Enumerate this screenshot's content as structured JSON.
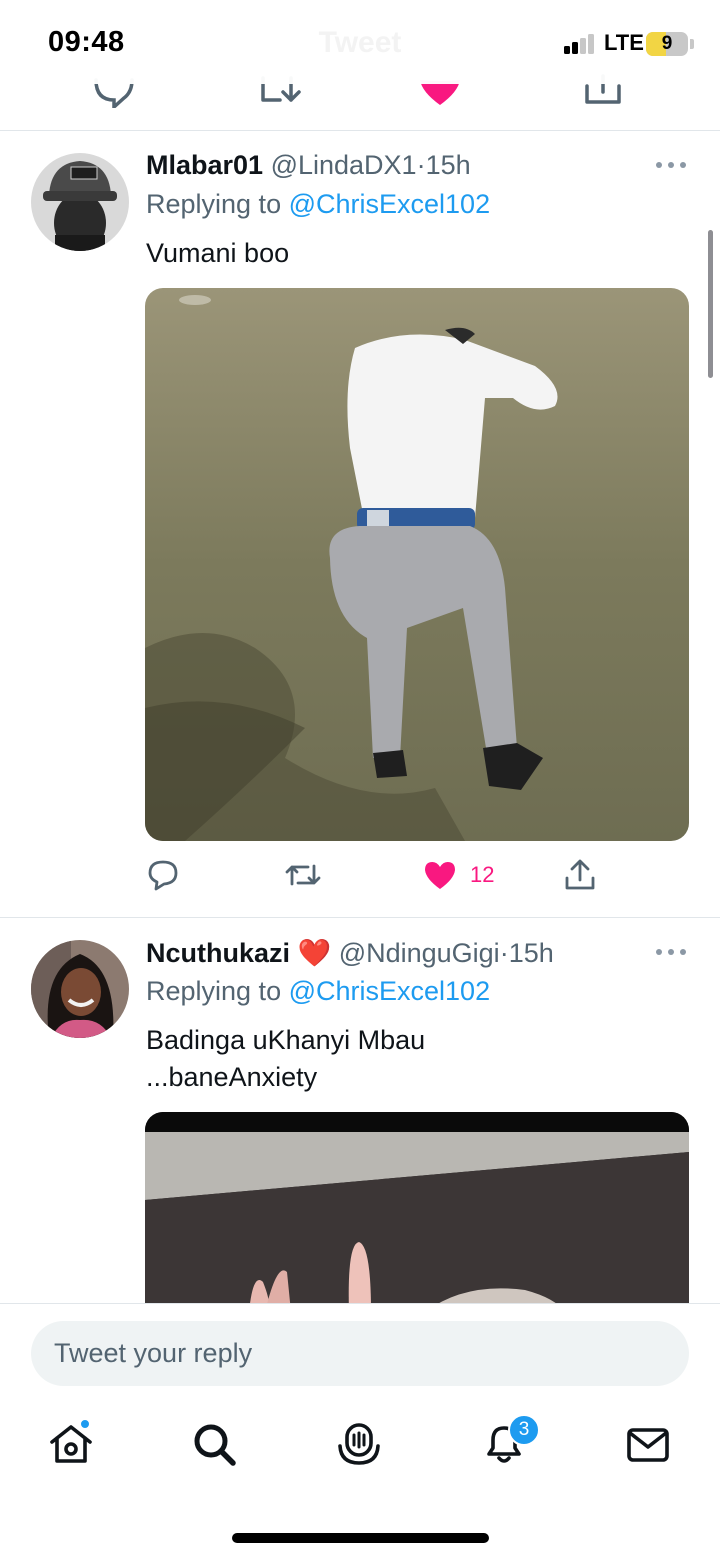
{
  "status_bar": {
    "time": "09:48",
    "header_title": "Tweet",
    "network": "LTE",
    "battery_level": "9"
  },
  "tweets": [
    {
      "display_name": "Mlabar01",
      "emoji": "",
      "handle": "@LindaDX1",
      "separator": "·",
      "time": "15h",
      "replying_prefix": "Replying to",
      "replying_to": "@ChrisExcel102",
      "text": "Vumani boo",
      "like_count": "12",
      "liked": true
    },
    {
      "display_name": "Ncuthukazi",
      "emoji": "❤️",
      "handle": "@NdinguGigi",
      "separator": "·",
      "time": "15h",
      "replying_prefix": "Replying to",
      "replying_to": "@ChrisExcel102",
      "text_line1": "Badinga uKhanyi Mbau",
      "text_line2": "...baneAnxiety"
    }
  ],
  "composer": {
    "placeholder": "Tweet your reply"
  },
  "tabbar": {
    "items": [
      "home-icon",
      "search-icon",
      "spaces-icon",
      "notifications-icon",
      "messages-icon"
    ],
    "notifications_badge": "3"
  },
  "colors": {
    "accent": "#1d9bf0",
    "like": "#f91880",
    "text_secondary": "#536471"
  }
}
